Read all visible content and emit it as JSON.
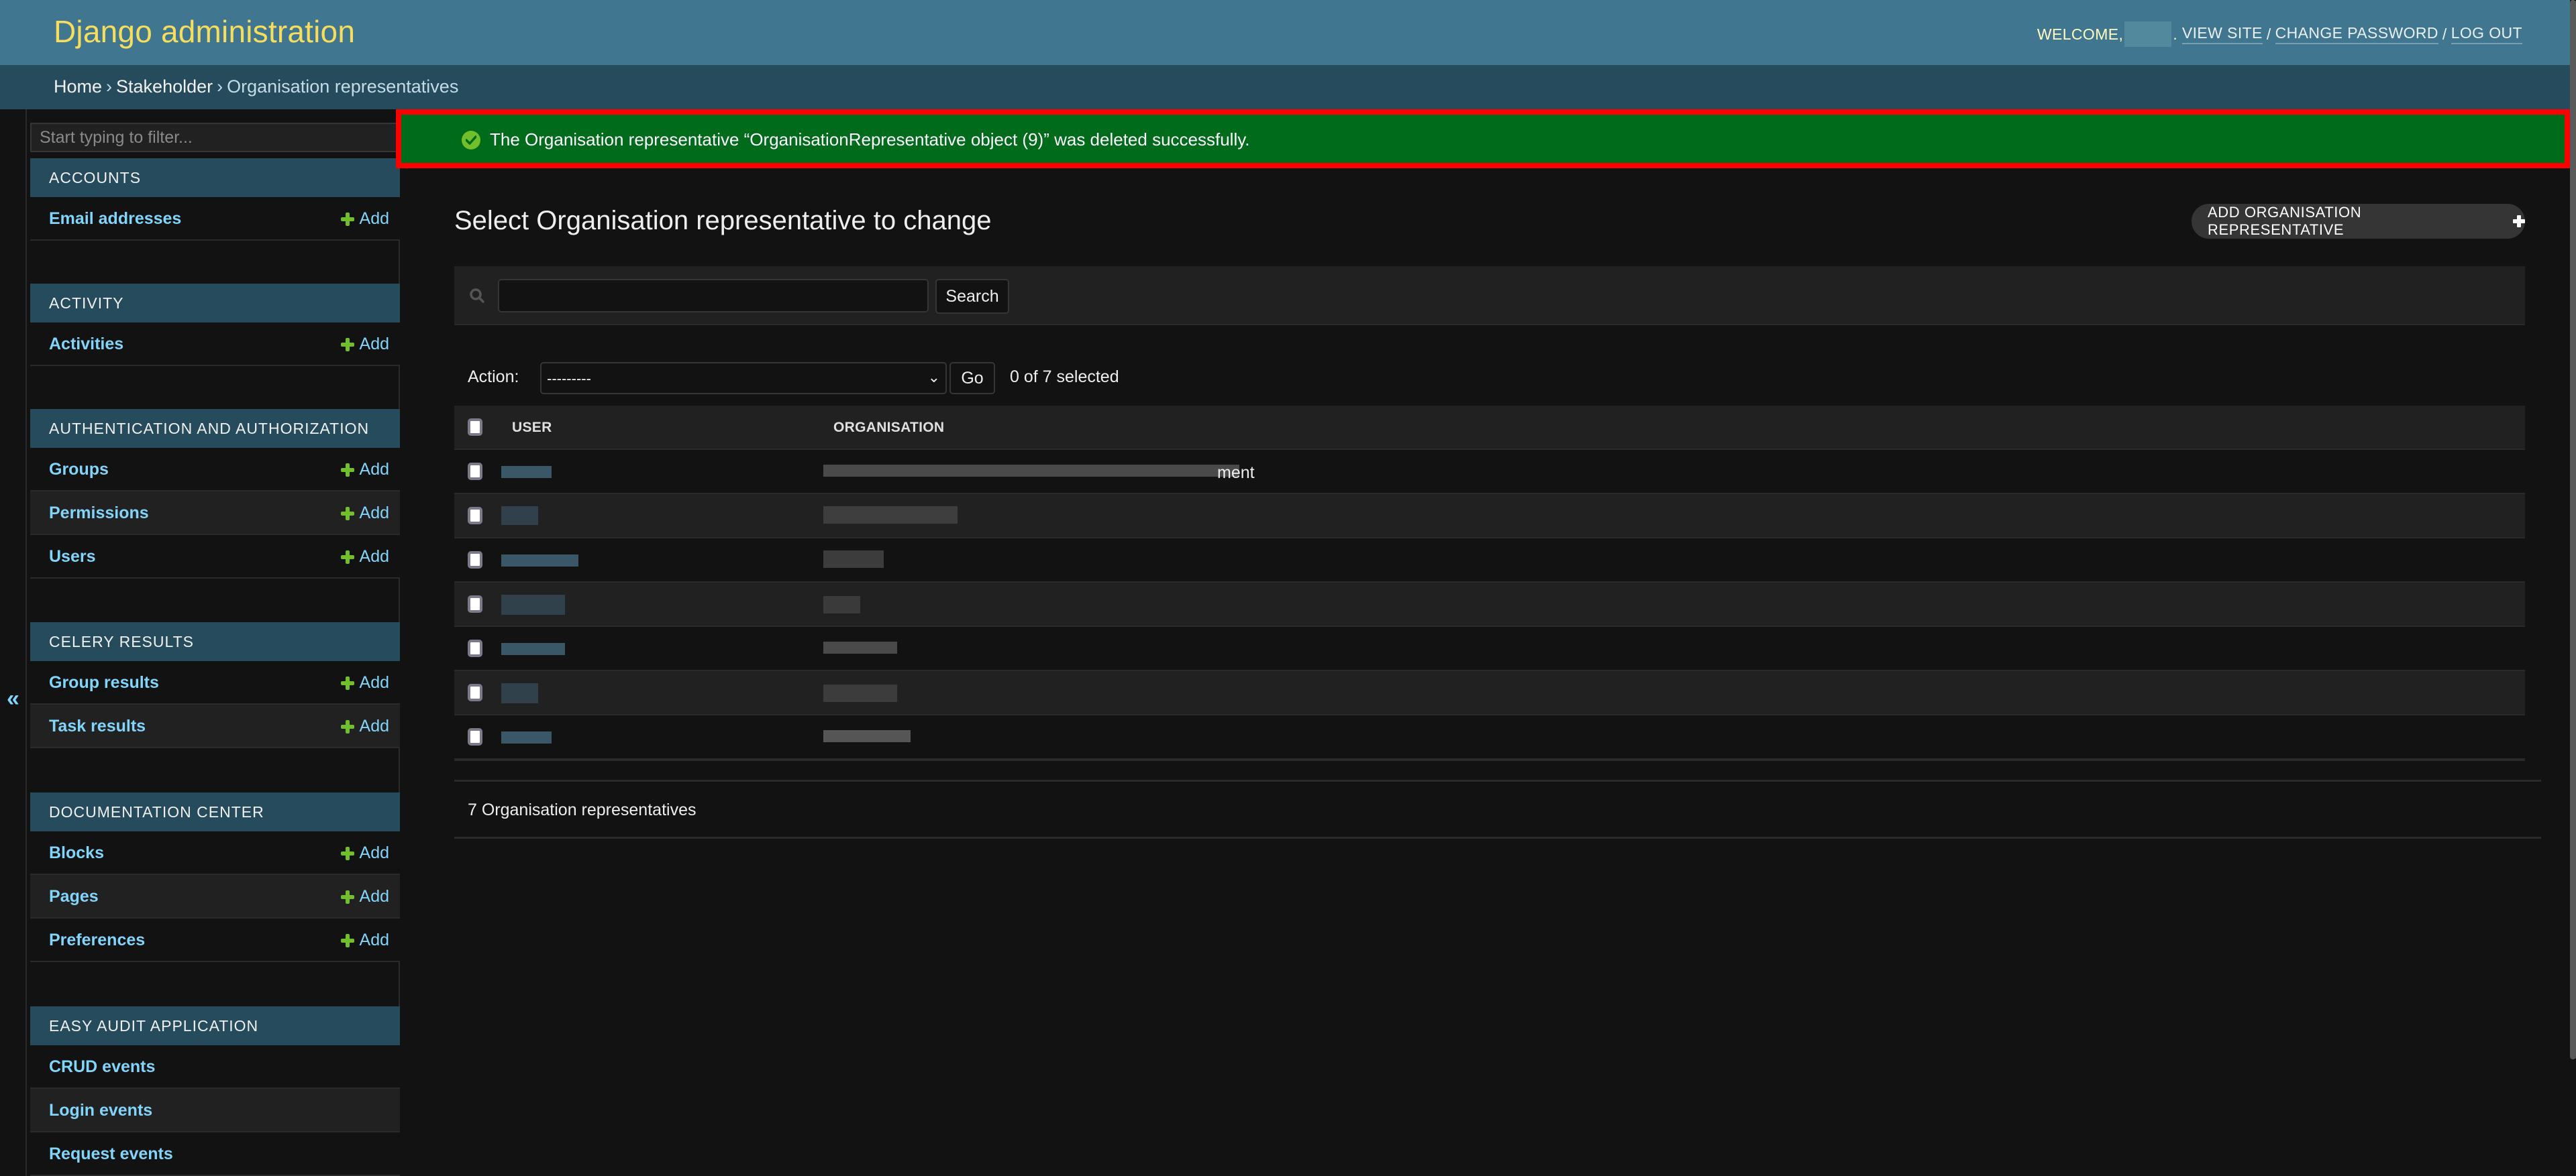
{
  "header": {
    "site_title": "Django administration",
    "welcome_label": "WELCOME,",
    "username_redacted": "",
    "user_links": [
      {
        "label": "VIEW SITE"
      },
      {
        "label": "CHANGE PASSWORD"
      },
      {
        "label": "LOG OUT"
      }
    ],
    "link_separator": "/"
  },
  "breadcrumbs": {
    "items": [
      "Home",
      "Stakeholder",
      "Organisation representatives"
    ],
    "separator": "›"
  },
  "sidebar": {
    "toggle_icon": "«",
    "filter_placeholder": "Start typing to filter...",
    "add_label": "Add",
    "modules": [
      {
        "caption": "ACCOUNTS",
        "models": [
          {
            "name": "Email addresses",
            "has_add": true
          }
        ]
      },
      {
        "caption": "ACTIVITY",
        "models": [
          {
            "name": "Activities",
            "has_add": true
          }
        ]
      },
      {
        "caption": "AUTHENTICATION AND AUTHORIZATION",
        "models": [
          {
            "name": "Groups",
            "has_add": true
          },
          {
            "name": "Permissions",
            "has_add": true
          },
          {
            "name": "Users",
            "has_add": true
          }
        ]
      },
      {
        "caption": "CELERY RESULTS",
        "models": [
          {
            "name": "Group results",
            "has_add": true
          },
          {
            "name": "Task results",
            "has_add": true
          }
        ]
      },
      {
        "caption": "DOCUMENTATION CENTER",
        "models": [
          {
            "name": "Blocks",
            "has_add": true
          },
          {
            "name": "Pages",
            "has_add": true
          },
          {
            "name": "Preferences",
            "has_add": true
          }
        ]
      },
      {
        "caption": "EASY AUDIT APPLICATION",
        "models": [
          {
            "name": "CRUD events",
            "has_add": false
          },
          {
            "name": "Login events",
            "has_add": false
          },
          {
            "name": "Request events",
            "has_add": false
          }
        ]
      }
    ]
  },
  "message": {
    "type": "success",
    "icon": "check-circle-icon",
    "text": "The Organisation representative “OrganisationRepresentative object (9)” was deleted successfully."
  },
  "main": {
    "title": "Select Organisation representative to change",
    "add_button_label": "ADD ORGANISATION REPRESENTATIVE",
    "search": {
      "value": "",
      "placeholder": "",
      "button_label": "Search"
    },
    "actions": {
      "label": "Action:",
      "selected_option": "---------",
      "go_label": "Go",
      "selection_counter": "0 of 7 selected"
    },
    "table": {
      "columns": [
        "USER",
        "ORGANISATION"
      ],
      "rows": [
        {
          "user": "[redacted]",
          "organisation": "[redacted]",
          "organisation_visible_tail": "ment"
        },
        {
          "user": "[redacted]",
          "organisation": "[redacted]",
          "organisation_visible_tail": ""
        },
        {
          "user": "[redacted]",
          "organisation": "[redacted]",
          "organisation_visible_tail": ""
        },
        {
          "user": "[redacted]",
          "organisation": "[redacted]",
          "organisation_visible_tail": ""
        },
        {
          "user": "[redacted]",
          "organisation": "[redacted]",
          "organisation_visible_tail": ""
        },
        {
          "user": "[redacted]",
          "organisation": "[redacted]",
          "organisation_visible_tail": ""
        },
        {
          "user": "[redacted]",
          "organisation": "[redacted]",
          "organisation_visible_tail": ""
        }
      ]
    },
    "result_count": "7 Organisation representatives"
  },
  "colors": {
    "header_bg": "#417690",
    "breadcrumb_bg": "#264b5d",
    "site_title": "#f5dd5d",
    "link": "#81d4fa",
    "add_green": "#70bf2b",
    "success_bg": "#006b1b",
    "highlight_border": "#ff0000",
    "page_bg": "#121212"
  }
}
